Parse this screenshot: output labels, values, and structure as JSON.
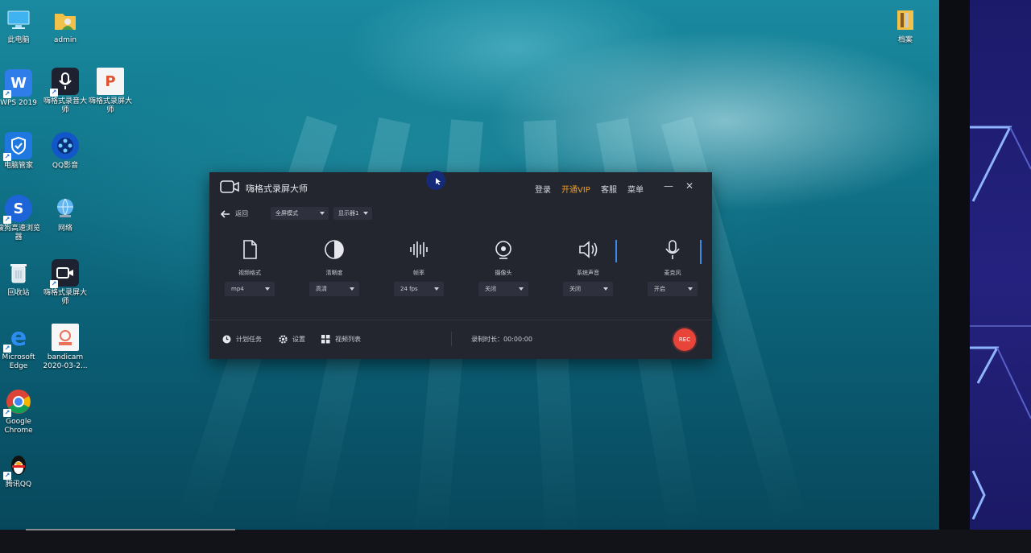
{
  "desktop": {
    "icons": [
      {
        "label": "此电脑"
      },
      {
        "label": "admin"
      },
      {
        "label": "WPS 2019"
      },
      {
        "label": "嗨格式录音大师"
      },
      {
        "label": "嗨格式录屏大师"
      },
      {
        "label": "电脑管家"
      },
      {
        "label": "QQ影音"
      },
      {
        "label": "搜狗高速浏览器"
      },
      {
        "label": "网络"
      },
      {
        "label": "回收站"
      },
      {
        "label": "嗨格式录屏大师"
      },
      {
        "label": "Microsoft Edge"
      },
      {
        "label": "bandicam 2020-03-2..."
      },
      {
        "label": "Google Chrome"
      },
      {
        "label": "腾讯QQ"
      },
      {
        "label": "档案"
      }
    ]
  },
  "recorder": {
    "title": "嗨格式录屏大师",
    "header_links": {
      "login": "登录",
      "vip": "开通VIP",
      "support": "客服",
      "menu": "菜单"
    },
    "window_controls": {
      "minimize": "—",
      "close": "✕"
    },
    "back_label": "返回",
    "mode_select": "全屏模式",
    "display_select": "显示器1",
    "columns": [
      {
        "label": "视频格式",
        "value": "mp4"
      },
      {
        "label": "清晰度",
        "value": "高清"
      },
      {
        "label": "帧率",
        "value": "24 fps"
      },
      {
        "label": "摄像头",
        "value": "关闭"
      },
      {
        "label": "系统声音",
        "value": "关闭"
      },
      {
        "label": "麦克风",
        "value": "开启"
      }
    ],
    "footer": {
      "schedule": "计划任务",
      "settings": "设置",
      "video_list": "视频列表",
      "duration_label": "录制时长：00:00:00",
      "rec": "REC"
    }
  },
  "colors": {
    "accent_vip": "#f0a024",
    "rec": "#e8443a",
    "window_bg": "#23252f"
  }
}
